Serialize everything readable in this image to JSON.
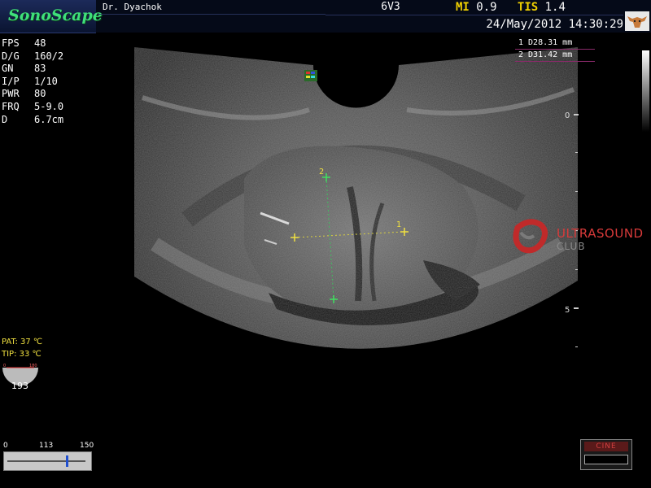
{
  "header": {
    "logo": "SonoScape",
    "doctor": "Dr. Dyachok",
    "probe": "6V3",
    "mi_label": "MI",
    "mi_value": "0.9",
    "tis_label": "TIS",
    "tis_value": "1.4",
    "datetime": "24/May/2012 14:30:29"
  },
  "params": [
    {
      "key": "FPS",
      "value": "48"
    },
    {
      "key": "D/G",
      "value": "160/2"
    },
    {
      "key": "GN",
      "value": "83"
    },
    {
      "key": "I/P",
      "value": "1/10"
    },
    {
      "key": "PWR",
      "value": "80"
    },
    {
      "key": "FRQ",
      "value": "5-9.0"
    },
    {
      "key": "D",
      "value": "6.7cm"
    }
  ],
  "measurements": [
    "1 D28.31 mm",
    "2 D31.42 mm"
  ],
  "caliper_labels": {
    "m1": "1",
    "m2": "2"
  },
  "temperatures": {
    "pat": "PAT: 37 ℃",
    "tip": "TIP: 33 ℃"
  },
  "gauge": {
    "min": "0",
    "max": "180",
    "value": "193"
  },
  "slider": {
    "min": "0",
    "mid": "113",
    "max": "150",
    "level": 113
  },
  "depth_scale": {
    "top": "0",
    "mid": "5"
  },
  "watermark": {
    "title": "ULTRASOUND",
    "subtitle": "CLUB"
  },
  "cine": {
    "label": "CINE"
  },
  "colors": {
    "accent_yellow": "#f0d000",
    "logo_green": "#3fe07a",
    "caliper_yellow": "#f0e040",
    "caliper_green": "#40e060"
  }
}
